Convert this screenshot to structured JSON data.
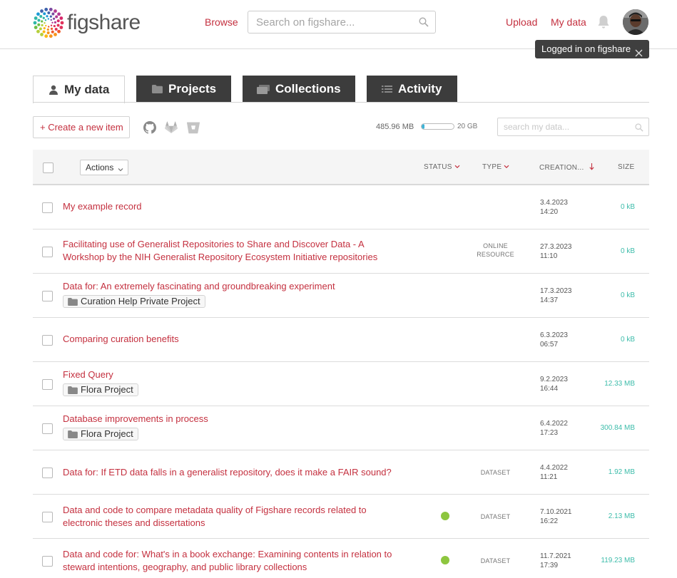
{
  "header": {
    "logo_text": "figshare",
    "browse": "Browse",
    "search_placeholder": "Search on figshare...",
    "upload": "Upload",
    "my_data": "My data",
    "tooltip": "Logged in on figshare"
  },
  "tabs": [
    {
      "label": "My data",
      "icon": "user-icon",
      "active": true
    },
    {
      "label": "Projects",
      "icon": "folder-icon",
      "active": false
    },
    {
      "label": "Collections",
      "icon": "collections-icon",
      "active": false
    },
    {
      "label": "Activity",
      "icon": "list-icon",
      "active": false
    }
  ],
  "toolbar": {
    "create": "+ Create a new item",
    "storage_used": "485.96 MB",
    "storage_fraction": 0.024,
    "storage_max": "20 GB",
    "search_placeholder": "search my data..."
  },
  "table": {
    "actions": "Actions",
    "columns": {
      "status": "STATUS",
      "type": "TYPE",
      "creation": "CREATION...",
      "size": "SIZE"
    },
    "rows": [
      {
        "title": "My example record",
        "project": "",
        "status": "",
        "type": "",
        "date": "3.4.2023",
        "time": "14:20",
        "size": "0 kB"
      },
      {
        "title": "Facilitating use of Generalist Repositories to Share and Discover Data - A Workshop by the NIH Generalist Repository Ecosystem Initiative repositories",
        "project": "",
        "status": "",
        "type": "ONLINE RESOURCE",
        "date": "27.3.2023",
        "time": "11:10",
        "size": "0 kB"
      },
      {
        "title": "Data for: An extremely fascinating and groundbreaking experiment",
        "project": "Curation Help Private Project",
        "status": "",
        "type": "",
        "date": "17.3.2023",
        "time": "14:37",
        "size": "0 kB"
      },
      {
        "title": "Comparing curation benefits",
        "project": "",
        "status": "",
        "type": "",
        "date": "6.3.2023",
        "time": "06:57",
        "size": "0 kB"
      },
      {
        "title": "Fixed Query",
        "project": "Flora Project",
        "status": "",
        "type": "",
        "date": "9.2.2023",
        "time": "16:44",
        "size": "12.33 MB"
      },
      {
        "title": "Database improvements in process",
        "project": "Flora Project",
        "status": "",
        "type": "",
        "date": "6.4.2022",
        "time": "17:23",
        "size": "300.84 MB"
      },
      {
        "title": "Data for: If ETD data falls in a generalist repository, does it make a FAIR sound?",
        "project": "",
        "status": "",
        "type": "DATASET",
        "date": "4.4.2022",
        "time": "11:21",
        "size": "1.92 MB"
      },
      {
        "title": "Data and code to compare metadata quality of Figshare records related to electronic theses and dissertations",
        "project": "",
        "status": "published",
        "type": "DATASET",
        "date": "7.10.2021",
        "time": "16:22",
        "size": "2.13 MB"
      },
      {
        "title": "Data and code for: What's in a book exchange: Examining contents in relation to steward intentions, geography, and public library collections",
        "project": "",
        "status": "published",
        "type": "DATASET",
        "date": "11.7.2021",
        "time": "17:39",
        "size": "119.23 MB"
      }
    ]
  },
  "colors": {
    "accent": "#c4303f",
    "size": "#3cbcaa",
    "published": "#8dc63f",
    "tab_dark": "#3c3c3c"
  }
}
